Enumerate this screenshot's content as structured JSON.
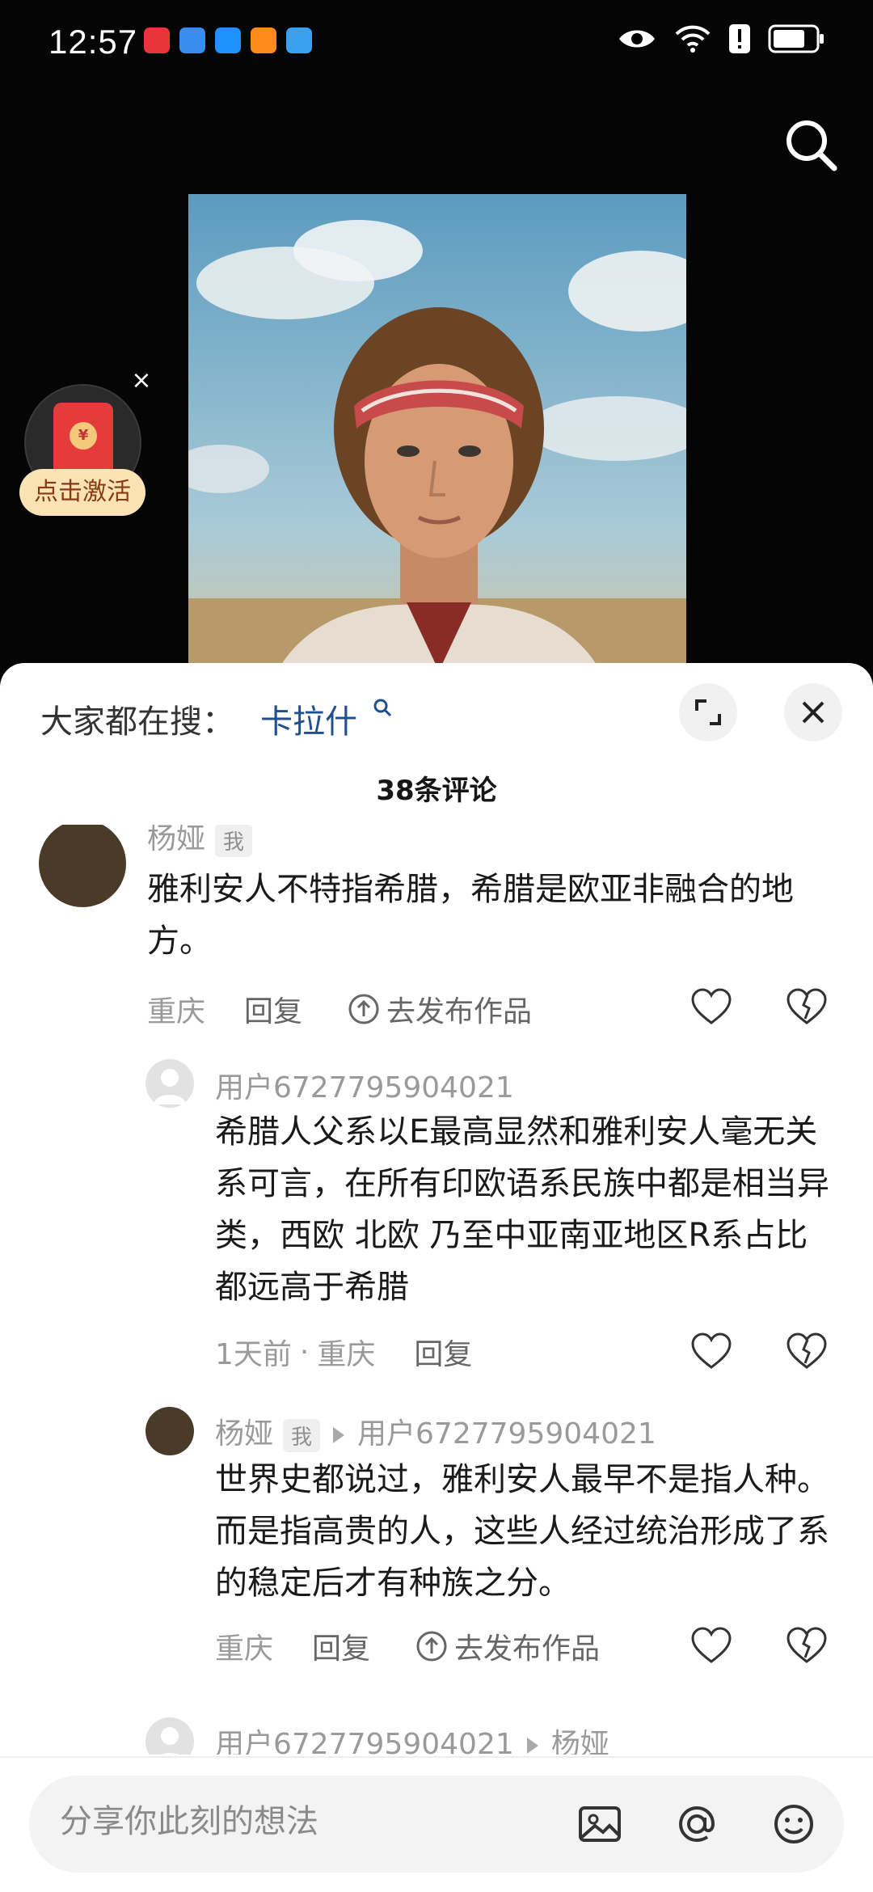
{
  "status_bar": {
    "time": "12:57",
    "app_icons": [
      {
        "name": "huawei-app-icon",
        "color": "#e8343a"
      },
      {
        "name": "browser-app-icon",
        "color": "#3a8df0"
      },
      {
        "name": "search-app-icon",
        "color": "#1e90ff"
      },
      {
        "name": "video-app-icon",
        "color": "#ff8a1e"
      },
      {
        "name": "weather-app-icon",
        "color": "#3aa0f0"
      }
    ],
    "right_icons": [
      "eye-icon",
      "wifi-icon",
      "alert-icon",
      "battery-icon"
    ]
  },
  "video": {
    "search_icon": "search-icon"
  },
  "red_packet": {
    "label": "点击激活",
    "close_symbol": "×",
    "coin_symbol": "¥"
  },
  "sheet": {
    "hot_search_prefix": "大家都在搜：",
    "hot_search_term": "卡拉什",
    "comment_count": "38条评论"
  },
  "comments": [
    {
      "author": "杨娅",
      "me_tag": "我",
      "text": "雅利安人不特指希腊，希腊是欧亚非融合的地方。",
      "location": "重庆",
      "reply": "回复",
      "publish": "去发布作品"
    },
    {
      "author": "用户6727795904021",
      "text": "希腊人父系以E最高显然和雅利安人毫无关系可言，在所有印欧语系民族中都是相当异类，西欧 北欧 乃至中亚南亚地区R系占比都远高于希腊",
      "time": "1天前",
      "dot": "·",
      "location": "重庆",
      "reply": "回复"
    },
    {
      "author": "杨娅",
      "me_tag": "我",
      "reply_to": "用户6727795904021",
      "text": "世界史都说过，雅利安人最早不是指人种。而是指高贵的人，这些人经过统治形成了系的稳定后才有种族之分。",
      "location": "重庆",
      "reply": "回复",
      "publish": "去发布作品"
    },
    {
      "author": "用户6727795904021",
      "reply_to": "杨娅"
    }
  ],
  "composer": {
    "placeholder": "分享你此刻的想法",
    "icons": [
      "image-icon",
      "at-icon",
      "emoji-icon"
    ]
  },
  "colors": {
    "accent_link": "#1f4f8f",
    "red_packet": "#e53b3b",
    "red_packet_label_bg": "#fbe3b6"
  }
}
